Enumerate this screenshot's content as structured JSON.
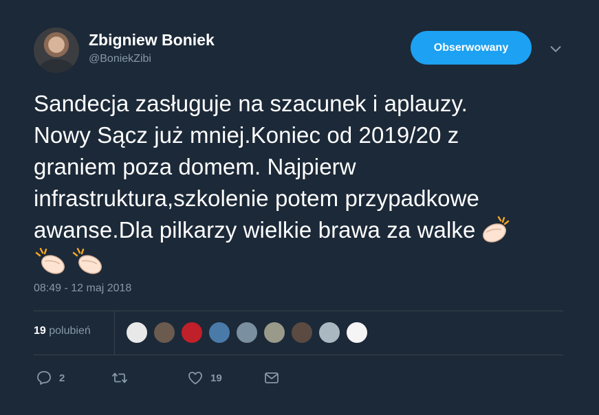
{
  "user": {
    "display_name": "Zbigniew Boniek",
    "handle": "@BoniekZibi",
    "avatar_icon": "user-photo"
  },
  "follow_button": {
    "label": "Obserwowany",
    "color": "#1da1f2"
  },
  "menu": {
    "icon": "chevron-down-icon"
  },
  "tweet": {
    "lines": [
      "Sandecja zasługuje na szacunek i aplauzy.",
      "Nowy Sącz już mniej.Koniec od 2019/20 z",
      "graniem poza domem. Najpierw",
      "infrastruktura,szkolenie potem przypadkowe",
      "awanse.Dla pilkarzy wielkie brawa za walke"
    ],
    "emoji": [
      "clapping-hands",
      "clapping-hands",
      "clapping-hands"
    ],
    "timestamp": "08:49 - 12 maj 2018"
  },
  "stats": {
    "likes_number": "19",
    "likes_label": "polubień",
    "liker_avatars": [
      {
        "name": "liker-avatar-1",
        "color": "#e8e8e8"
      },
      {
        "name": "liker-avatar-2",
        "color": "#6b5a4e"
      },
      {
        "name": "liker-avatar-3",
        "color": "#c0202a"
      },
      {
        "name": "liker-avatar-4",
        "color": "#4a7aa8"
      },
      {
        "name": "liker-avatar-5",
        "color": "#7a8fa0"
      },
      {
        "name": "liker-avatar-6",
        "color": "#9a9a8a"
      },
      {
        "name": "liker-avatar-7",
        "color": "#5b4a42"
      },
      {
        "name": "liker-avatar-8",
        "color": "#aab8c2"
      },
      {
        "name": "liker-avatar-9",
        "color": "#f5f5f5"
      }
    ]
  },
  "actions": {
    "reply": {
      "icon": "reply-icon",
      "count": "2"
    },
    "retweet": {
      "icon": "retweet-icon",
      "count": ""
    },
    "like": {
      "icon": "heart-icon",
      "count": "19"
    },
    "message": {
      "icon": "envelope-icon",
      "count": ""
    }
  },
  "colors": {
    "background": "#1c2938",
    "text": "#ffffff",
    "muted": "#8899a6",
    "divider": "#38444d"
  }
}
